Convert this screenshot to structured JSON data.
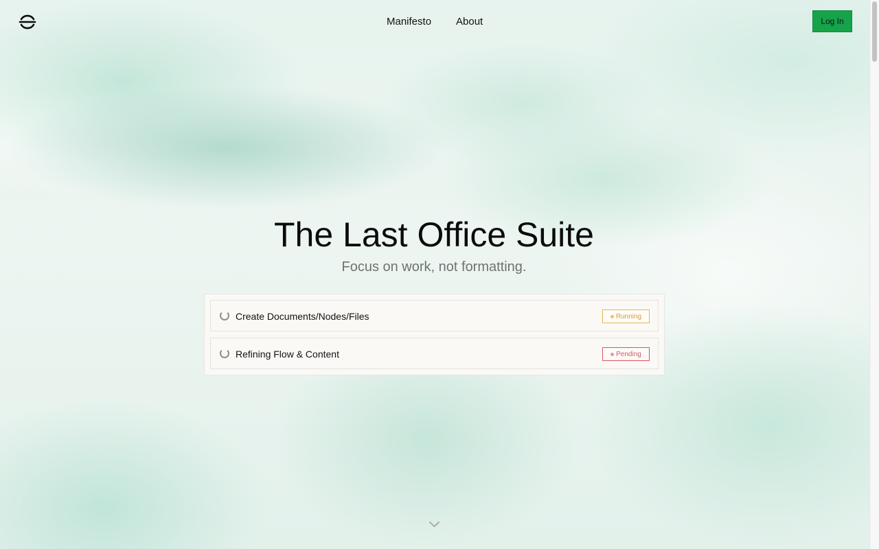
{
  "nav": {
    "links": [
      "Manifesto",
      "About"
    ],
    "login_label": "Log In"
  },
  "hero": {
    "title": "The Last Office Suite",
    "subtitle": "Focus on work, not formatting."
  },
  "tasks": [
    {
      "label": "Create Documents/Nodes/Files",
      "status": "Running"
    },
    {
      "label": "Refining Flow & Content",
      "status": "Pending"
    }
  ],
  "colors": {
    "accent": "#16a34a",
    "running": "#d79b3a",
    "pending": "#d05b63"
  },
  "icons": {
    "logo": "logo-icon",
    "spinner": "spinner-icon",
    "scroll_down": "chevron-down-icon"
  }
}
